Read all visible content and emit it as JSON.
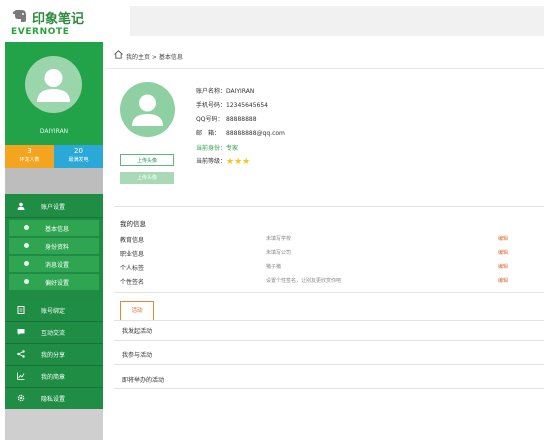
{
  "brand": {
    "name_cn": "印象笔记",
    "name_en": "EVERNOTE"
  },
  "sidebar": {
    "username": "DAIYIRAN",
    "stats": [
      {
        "value": "3",
        "label": "环龙人数"
      },
      {
        "value": "20",
        "label": "最满发电"
      }
    ],
    "menu": [
      {
        "label": "账户设置",
        "icon": "user-icon"
      },
      {
        "label": "账号绑定",
        "icon": "document-icon"
      },
      {
        "label": "互动交流",
        "icon": "chat-icon"
      },
      {
        "label": "我的分享",
        "icon": "share-icon"
      },
      {
        "label": "我的简章",
        "icon": "chart-icon"
      },
      {
        "label": "隐私设置",
        "icon": "gear-icon"
      }
    ],
    "submenu": [
      {
        "label": "基本信息"
      },
      {
        "label": "身份资料"
      },
      {
        "label": "消息设置"
      },
      {
        "label": "偏好设置"
      }
    ]
  },
  "breadcrumb": {
    "text": "我的主页 > 基本信息"
  },
  "profile": {
    "upload_button": "上传头像",
    "upload_button2": "上传头像",
    "fields": [
      {
        "label": "账户名称：",
        "value": "DAIYIRAN"
      },
      {
        "label": "手机号码：",
        "value": "12345645654"
      },
      {
        "label": "QQ号码：",
        "value": "88888888"
      },
      {
        "label": "邮　箱：",
        "value": "88888888@qq.com"
      }
    ],
    "identity_label": "当前身份：",
    "identity_value": "专家",
    "level_label": "当前等级：",
    "level_stars": "★★★"
  },
  "my_info": {
    "title": "我的信息",
    "rows": [
      {
        "label": "教育信息",
        "value": "未填写学校",
        "edit": "编辑"
      },
      {
        "label": "职业信息",
        "value": "未填写公司",
        "edit": "编辑"
      },
      {
        "label": "个人标签",
        "value": "猪子猪",
        "edit": "编辑"
      },
      {
        "label": "个性签名",
        "value": "设置个性签名，让别友更欣赏你吧",
        "edit": "编辑"
      }
    ]
  },
  "activity": {
    "tab_label": "活动",
    "rows": [
      {
        "label": "我发起活动"
      },
      {
        "label": "我参与活动"
      },
      {
        "label": "即将举办的活动"
      }
    ]
  },
  "colors": {
    "primary_green": "#1e8c43",
    "light_green": "#22a34a",
    "orange": "#f3a51f",
    "blue": "#2aa8d8",
    "edit_orange": "#e06a2c"
  }
}
